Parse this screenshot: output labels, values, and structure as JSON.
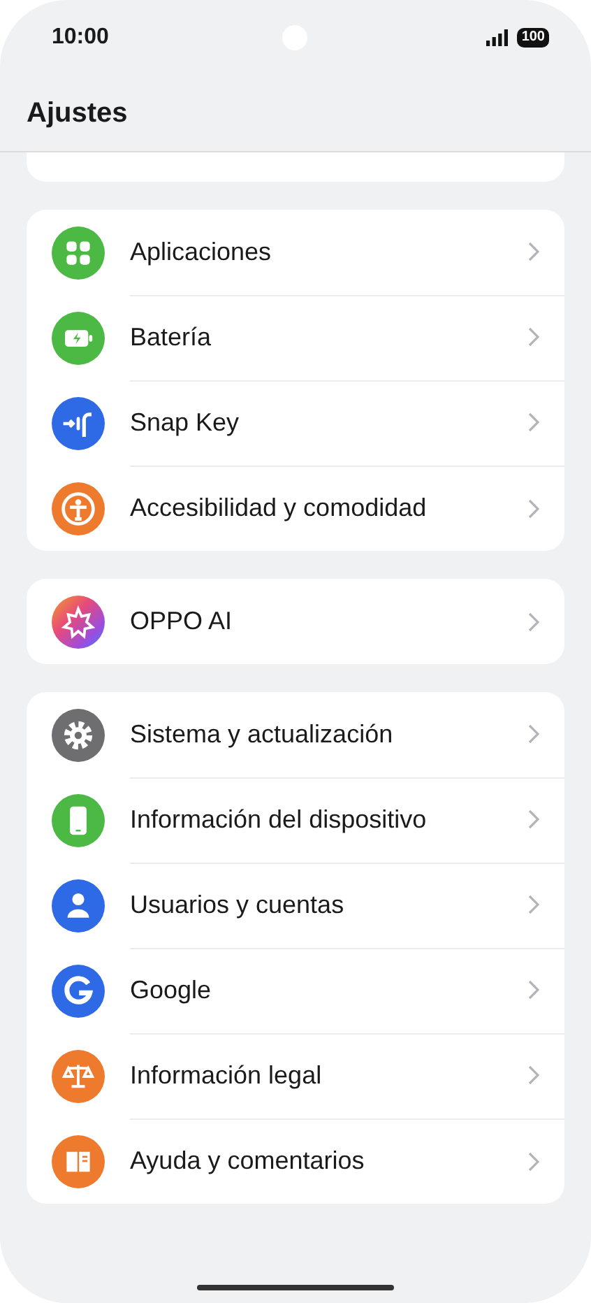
{
  "status_bar": {
    "time": "10:00",
    "battery": "100"
  },
  "header": {
    "title": "Ajustes"
  },
  "groups": [
    {
      "items": [
        {
          "label": "Aplicaciones"
        },
        {
          "label": "Batería"
        },
        {
          "label": "Snap Key"
        },
        {
          "label": "Accesibilidad y comodidad"
        }
      ]
    },
    {
      "items": [
        {
          "label": "OPPO AI"
        }
      ]
    },
    {
      "items": [
        {
          "label": "Sistema y actualización"
        },
        {
          "label": "Información del dispositivo"
        },
        {
          "label": "Usuarios y cuentas"
        },
        {
          "label": "Google"
        },
        {
          "label": "Información legal"
        },
        {
          "label": "Ayuda y comentarios"
        }
      ]
    }
  ]
}
